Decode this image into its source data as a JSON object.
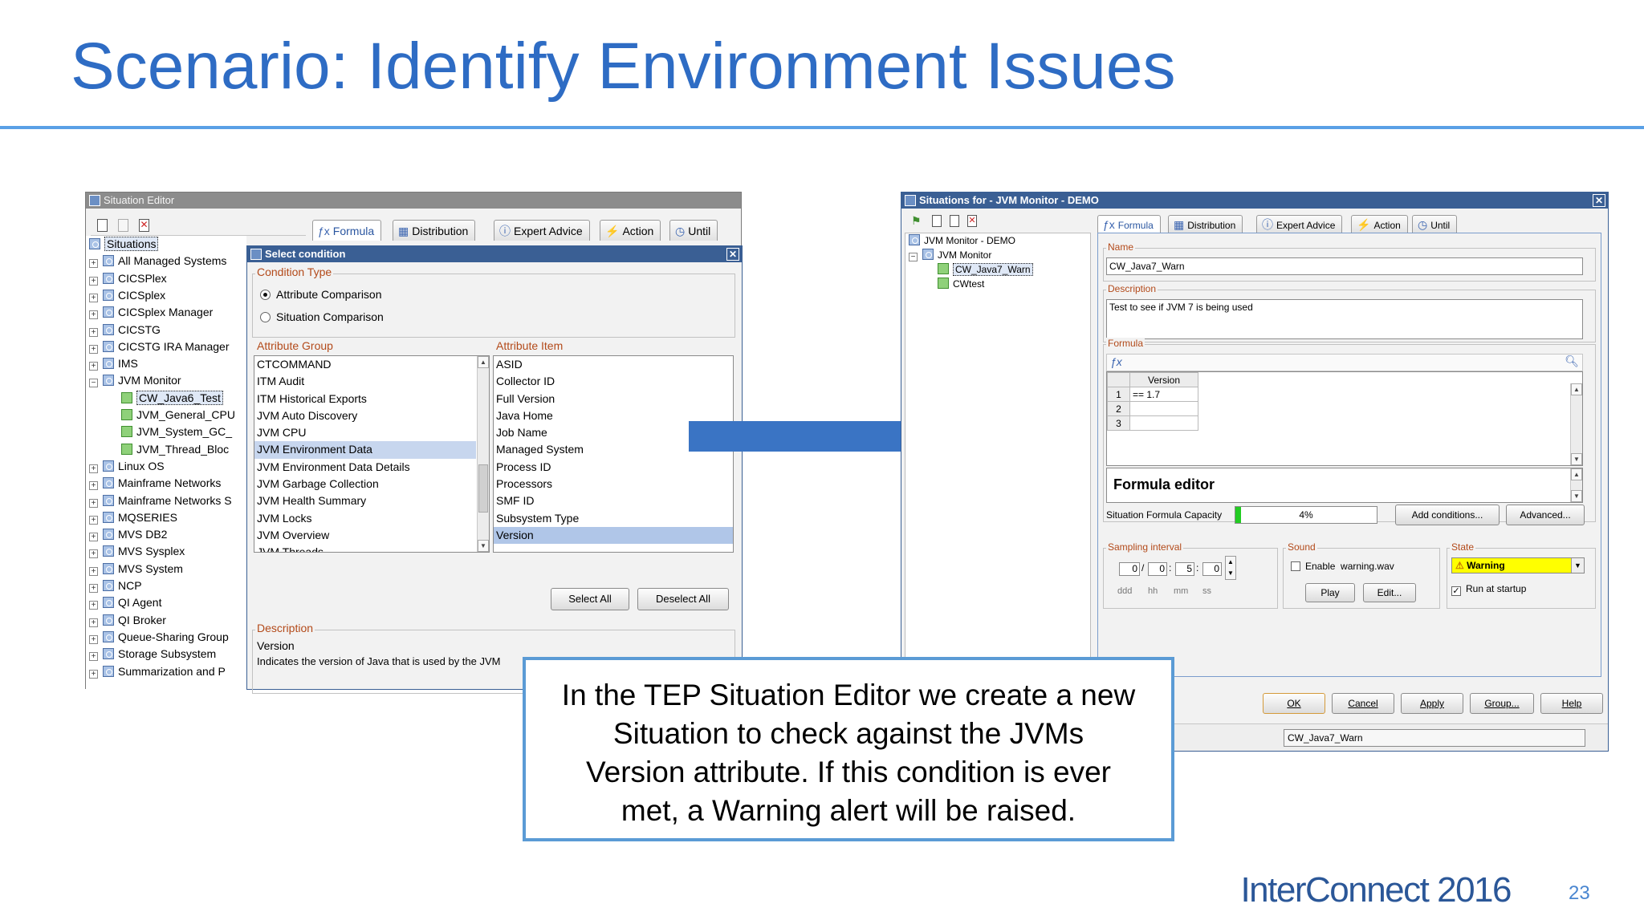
{
  "slide": {
    "title": "Scenario: Identify Environment Issues",
    "brand": "InterConnect 2016",
    "page_number": "23",
    "callout_lines": [
      "In the TEP Situation Editor we create a new",
      "Situation to check against the JVMs",
      "Version attribute. If this condition is ever",
      "met, a Warning alert will be raised."
    ]
  },
  "colors": {
    "title": "#2e6cc4",
    "rule": "#5aa0e6",
    "arrow": "#3a74c4",
    "callout_border": "#5b9bd5",
    "titlebar": "#3a5f94",
    "warning": "#ffff00",
    "capacity_bar": "#22cc22"
  },
  "editor_left": {
    "window_title": "Situation Editor",
    "tabs": [
      "Formula",
      "Distribution",
      "Expert Advice",
      "Action",
      "Until"
    ],
    "tree_root": "Situations",
    "tree": [
      "All Managed Systems",
      "CICSPlex",
      "CICSplex",
      "CICSplex Manager",
      "CICSTG",
      "CICSTG IRA Manager",
      "IMS",
      "JVM Monitor"
    ],
    "tree_children": [
      "CW_Java6_Test",
      "JVM_General_CPU",
      "JVM_System_GC_",
      "JVM_Thread_Bloc"
    ],
    "tree_after": [
      "Linux OS",
      "Mainframe Networks",
      "Mainframe Networks S",
      "MQSERIES",
      "MVS DB2",
      "MVS Sysplex",
      "MVS System",
      "NCP",
      "QI Agent",
      "QI Broker",
      "Queue-Sharing Group",
      "Storage Subsystem",
      "Summarization and P"
    ]
  },
  "select_condition": {
    "title": "Select condition",
    "condition_type_label": "Condition Type",
    "option_attribute": "Attribute Comparison",
    "option_situation": "Situation Comparison",
    "attribute_group_label": "Attribute Group",
    "attribute_groups": [
      "CTCOMMAND",
      "ITM Audit",
      "ITM Historical Exports",
      "JVM Auto Discovery",
      "JVM CPU",
      "JVM Environment Data",
      "JVM Environment Data Details",
      "JVM Garbage Collection",
      "JVM Health Summary",
      "JVM Locks",
      "JVM Overview",
      "JVM Threads"
    ],
    "attribute_item_label": "Attribute Item",
    "attribute_items": [
      "ASID",
      "Collector ID",
      "Full Version",
      "Java Home",
      "Job Name",
      "Managed System",
      "Process ID",
      "Processors",
      "SMF ID",
      "Subsystem Type",
      "Version"
    ],
    "select_all": "Select All",
    "deselect_all": "Deselect All",
    "description_label": "Description",
    "description_title": "Version",
    "description_text": "Indicates the version of Java that is used by the JVM"
  },
  "editor_right": {
    "window_title": "Situations for - JVM Monitor - DEMO",
    "tree": [
      "JVM Monitor - DEMO",
      "JVM Monitor",
      "CW_Java7_Warn",
      "CWtest"
    ],
    "tabs": [
      "Formula",
      "Distribution",
      "Expert Advice",
      "Action",
      "Until"
    ],
    "name_label": "Name",
    "name_value": "CW_Java7_Warn",
    "description_label": "Description",
    "description_value": "Test to see if JVM 7 is being used",
    "formula_label": "Formula",
    "formula_column": "Version",
    "formula_rows": [
      {
        "n": "1",
        "v": "== 1.7"
      },
      {
        "n": "2",
        "v": ""
      },
      {
        "n": "3",
        "v": ""
      }
    ],
    "formula_editor": "Formula editor",
    "capacity_label": "Situation Formula Capacity",
    "capacity_percent": "4%",
    "capacity_fraction": 0.04,
    "add_conditions": "Add conditions...",
    "advanced": "Advanced...",
    "sampling_label": "Sampling interval",
    "sampling": {
      "ddd": "0",
      "hh": "0",
      "mm": "5",
      "ss": "0"
    },
    "sampling_units": [
      "ddd",
      "hh",
      "mm",
      "ss"
    ],
    "sound_label": "Sound",
    "sound_enable": "Enable",
    "sound_file": "warning.wav",
    "play": "Play",
    "edit": "Edit...",
    "state_label": "State",
    "state_value": "Warning",
    "run_at_startup": "Run at startup",
    "buttons": [
      "OK",
      "Cancel",
      "Apply",
      "Group...",
      "Help"
    ],
    "status_text": "CW_Java7_Warn"
  }
}
